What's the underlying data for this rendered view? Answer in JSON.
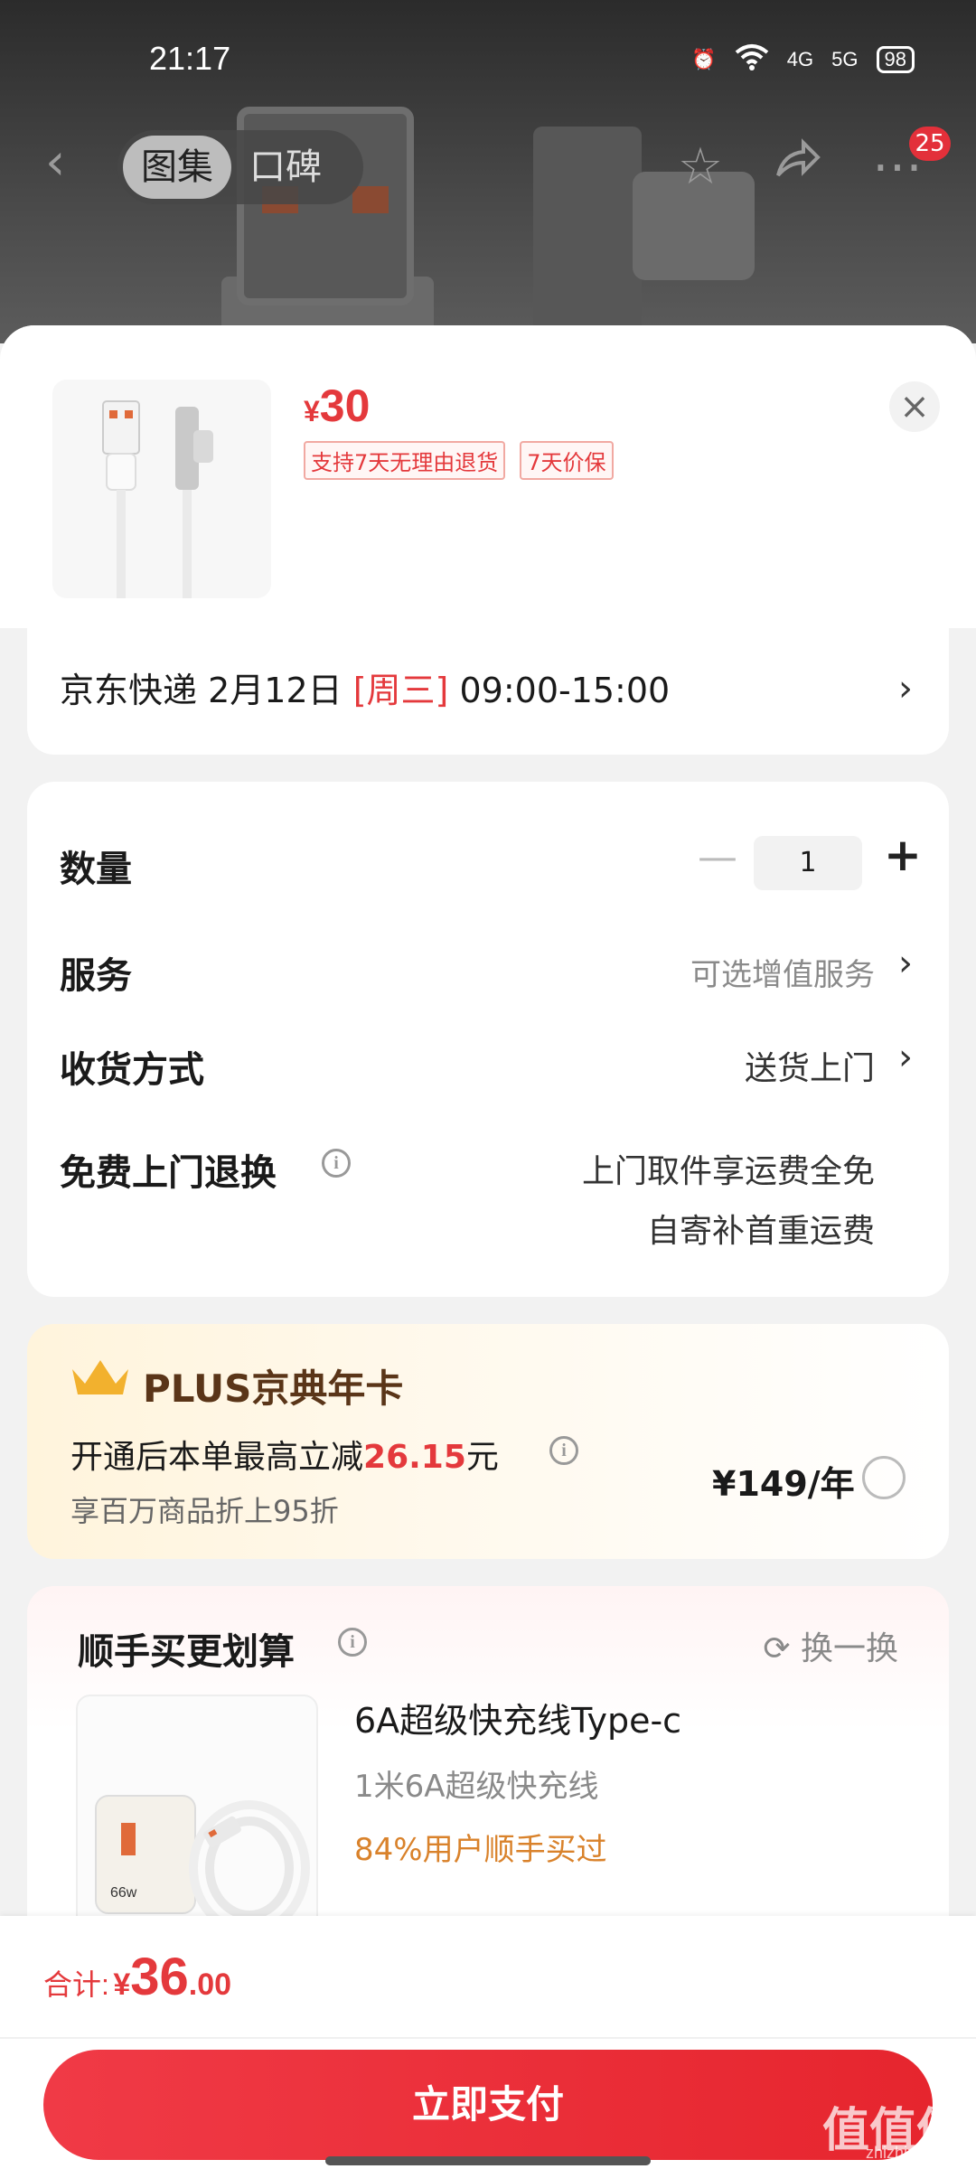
{
  "status_bar": {
    "time": "21:17",
    "net1": "4G",
    "net2": "5G",
    "battery": "98"
  },
  "nav": {
    "tabs": [
      "图集",
      "口碑"
    ],
    "active_tab": 0,
    "badge_count": "25"
  },
  "product": {
    "currency": "¥",
    "price": "30",
    "tags": [
      "支持7天无理由退货",
      "7天价保"
    ]
  },
  "delivery": {
    "carrier": "京东快递",
    "date": "2月12日",
    "weekday": "[周三]",
    "time_window": "09:00-15:00"
  },
  "options": {
    "quantity_label": "数量",
    "quantity_value": "1",
    "service_label": "服务",
    "service_value": "可选增值服务",
    "receive_label": "收货方式",
    "receive_value": "送货上门",
    "return_label": "免费上门退换",
    "return_value_1": "上门取件享运费全免",
    "return_value_2": "自寄补首重运费"
  },
  "plus": {
    "title": "PLUS京典年卡",
    "line1_prefix": "开通后本单最高立减",
    "line1_amount": "26.15",
    "line1_suffix": "元",
    "line2": "享百万商品折上95折",
    "price": "¥149/年"
  },
  "recommend": {
    "title": "顺手买更划算",
    "refresh_label": "换一换",
    "item": {
      "name": "6A超级快充线Type-c",
      "subtitle": "1米6A超级快充线",
      "stat": "84%用户顺手买过",
      "thumb_label": "66w"
    }
  },
  "footer": {
    "total_label": "合计:",
    "currency": "¥",
    "total_int": "36",
    "total_dec": ".00",
    "pay_label": "立即支付",
    "watermark": "值值值",
    "watermark_sub": "zhizhizhi.com"
  },
  "colors": {
    "accent": "#e4393c",
    "plus_brown": "#5a3518",
    "stat_orange": "#d9822b"
  }
}
